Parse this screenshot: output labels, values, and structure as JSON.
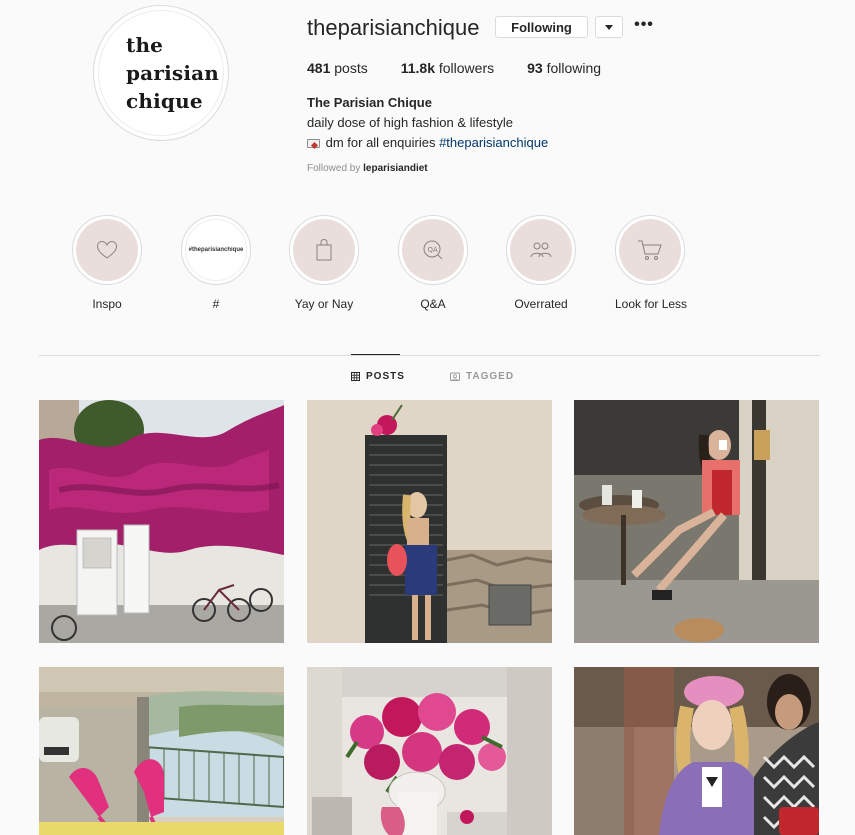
{
  "profile": {
    "avatar_lines": [
      "the",
      "parisian",
      "chique"
    ],
    "username": "theparisianchique",
    "follow_label": "Following",
    "more_label": "•••",
    "stats": {
      "posts_count": "481",
      "posts_label": " posts",
      "followers_count": "11.8k",
      "followers_label": " followers",
      "following_count": "93",
      "following_label": " following"
    },
    "bio": {
      "name": "The Parisian Chique",
      "line1": "daily dose of high fashion & lifestyle",
      "line2_text": " dm for all enquiries ",
      "line2_hashtag": "#theparisianchique"
    },
    "followed_by_prefix": "Followed by ",
    "followed_by_user": "leparisiandiet"
  },
  "highlights": [
    {
      "label": "Inspo",
      "icon": "heart-icon"
    },
    {
      "label": "#",
      "icon": "text-cover",
      "cover_text": "#theparisianchique"
    },
    {
      "label": "Yay or Nay",
      "icon": "shopping-bag-icon"
    },
    {
      "label": "Q&A",
      "icon": "qa-icon"
    },
    {
      "label": "Overrated",
      "icon": "people-icon"
    },
    {
      "label": "Look for Less",
      "icon": "cart-icon"
    }
  ],
  "tabs": {
    "posts": "POSTS",
    "tagged": "TAGGED"
  },
  "grid": [
    {
      "subject": "bougainvillea-house"
    },
    {
      "subject": "woman-by-green-door"
    },
    {
      "subject": "woman-at-cafe"
    },
    {
      "subject": "pink-heels-in-car"
    },
    {
      "subject": "pink-peonies"
    },
    {
      "subject": "woman-in-pink-beret"
    }
  ],
  "colors": {
    "background": "#fafafa",
    "text": "#262626",
    "muted": "#8e8e8e",
    "link": "#00376b",
    "highlight_fill": "#e9dedb",
    "border": "#dbdbdb"
  }
}
